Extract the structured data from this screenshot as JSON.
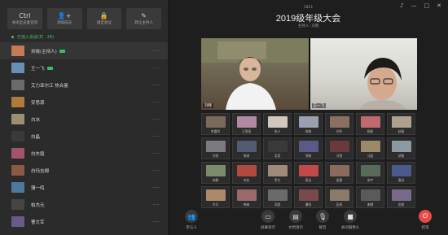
{
  "sidebar": {
    "toolbar": [
      {
        "icon": "mic-off-icon",
        "glyph": "Ctrl",
        "label": "关闭全员麦克风"
      },
      {
        "icon": "add-member-icon",
        "glyph": "👤+",
        "label": "添加成员"
      },
      {
        "icon": "lock-icon",
        "glyph": "🔒",
        "label": "锁定会议"
      },
      {
        "icon": "host-icon",
        "glyph": "✎",
        "label": "转让主持人"
      }
    ],
    "online_label": "已加入会议(共 · 24)",
    "members": [
      {
        "name": "刘晓(主持人)",
        "cam": true,
        "color": "#c47a55"
      },
      {
        "name": "王一飞",
        "cam": true,
        "color": "#6a8fb5"
      },
      {
        "name": "艾力亚尔江 热合曼",
        "cam": false,
        "color": "#6b6b6b"
      },
      {
        "name": "安思源",
        "cam": false,
        "color": "#b07a3a"
      },
      {
        "name": "白冰",
        "cam": false,
        "color": "#9a8f70"
      },
      {
        "name": "白晶",
        "cam": false,
        "color": "#3a3a3a"
      },
      {
        "name": "白东霞",
        "cam": false,
        "color": "#a4546a"
      },
      {
        "name": "白玛吉姆",
        "cam": false,
        "color": "#8a5a45"
      },
      {
        "name": "薄一鸣",
        "cam": false,
        "color": "#4a7aa0"
      },
      {
        "name": "柏杰元",
        "cam": false,
        "color": "#454545"
      },
      {
        "name": "曹文军",
        "cam": false,
        "color": "#6a5a8a"
      }
    ],
    "more_glyph": "···"
  },
  "window_controls": [
    "♪",
    "—",
    "□",
    "✕"
  ],
  "meeting": {
    "id": "1821",
    "title": "2019级年级大会",
    "subtitle": "主持人: 刘晓"
  },
  "main_video": {
    "left_name": "刘晓",
    "right_name": "王一飞"
  },
  "grid": [
    {
      "name": "李嘉欣",
      "color": "#7a6a5a"
    },
    {
      "name": "王思雨",
      "color": "#b08aa0"
    },
    {
      "name": "张小",
      "color": "#d0c8bc"
    },
    {
      "name": "陈晓",
      "color": "#9aa0b0"
    },
    {
      "name": "刘丹",
      "color": "#8a7060"
    },
    {
      "name": "杨帆",
      "color": "#c06a70"
    },
    {
      "name": "赵磊",
      "color": "#b0a090"
    },
    {
      "name": "孙悦",
      "color": "#7a7a80"
    },
    {
      "name": "周琪",
      "color": "#505a70"
    },
    {
      "name": "吴昊",
      "color": "#3a3a3a"
    },
    {
      "name": "郑爽",
      "color": "#5a5a8a"
    },
    {
      "name": "冯雪",
      "color": "#6a3a3a"
    },
    {
      "name": "马超",
      "color": "#9a8a6a"
    },
    {
      "name": "胡杨",
      "color": "#8a9aa0"
    },
    {
      "name": "林静",
      "color": "#7a8a6a"
    },
    {
      "name": "何佳",
      "color": "#b04a40"
    },
    {
      "name": "罗文",
      "color": "#a08a7a"
    },
    {
      "name": "高洁",
      "color": "#c04a4a"
    },
    {
      "name": "梁晨",
      "color": "#8a6a5a"
    },
    {
      "name": "宋宇",
      "color": "#5a6a5a"
    },
    {
      "name": "唐诗",
      "color": "#4a5a8a"
    },
    {
      "name": "许可",
      "color": "#aa8a6a"
    },
    {
      "name": "韩梅",
      "color": "#9a6a6a"
    },
    {
      "name": "邓超",
      "color": "#6a6a6a"
    },
    {
      "name": "曹阳",
      "color": "#7a4a4a"
    },
    {
      "name": "彭亮",
      "color": "#8a7a6a"
    },
    {
      "name": "谢娜",
      "color": "#5a5a5a"
    },
    {
      "name": "田甜",
      "color": "#7a6a8a"
    }
  ],
  "bottom_bar": [
    {
      "icon": "participants-icon",
      "glyph": "👥",
      "label": "参与人"
    },
    {
      "icon": "share-screen-icon",
      "glyph": "▭",
      "label": "屏幕演示"
    },
    {
      "icon": "share-doc-icon",
      "glyph": "▤",
      "label": "文档演示"
    },
    {
      "icon": "mic-icon",
      "glyph": "🎙",
      "label": "静音"
    },
    {
      "icon": "camera-icon",
      "glyph": "■",
      "label": "关闭摄像头"
    },
    {
      "icon": "end-call-icon",
      "glyph": "⏻",
      "label": "结束"
    }
  ]
}
